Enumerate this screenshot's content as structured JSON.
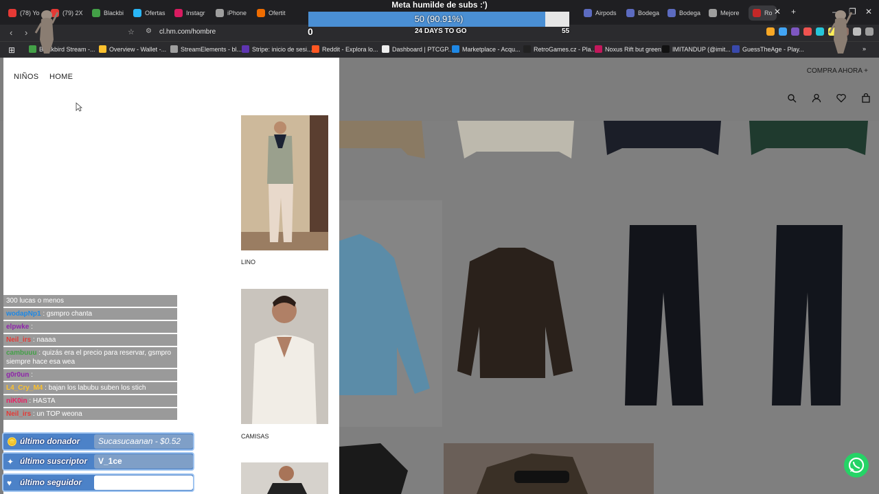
{
  "browser": {
    "tabs": [
      {
        "label": "(78) Yo",
        "color": "#e53935"
      },
      {
        "label": "(79) 2X",
        "color": "#e53935"
      },
      {
        "label": "Blackbi",
        "color": "#43a047"
      },
      {
        "label": "Ofertas",
        "color": "#29b6f6"
      },
      {
        "label": "Instagr",
        "color": "#d81b60"
      },
      {
        "label": "iPhone",
        "color": "#9e9e9e"
      },
      {
        "label": "Ofertit",
        "color": "#ef6c00"
      },
      {
        "label": "Airpods",
        "color": "#5c6bc0"
      },
      {
        "label": "Bodega",
        "color": "#5c6bc0"
      },
      {
        "label": "Bodega",
        "color": "#5c6bc0"
      },
      {
        "label": "Mejore",
        "color": "#9e9e9e"
      },
      {
        "label": "Ro",
        "color": "#c62828"
      }
    ],
    "url": "cl.hm.com/hombre",
    "bookmarks": [
      {
        "label": "Blackbird Stream -...",
        "color": "#43a047"
      },
      {
        "label": "Overview - Wallet -...",
        "color": "#fbc02d"
      },
      {
        "label": "StreamElements - bl...",
        "color": "#9e9e9e"
      },
      {
        "label": "Stripe: inicio de sesi...",
        "color": "#5e35b1"
      },
      {
        "label": "Reddit - Explora lo...",
        "color": "#ff5722"
      },
      {
        "label": "Dashboard | PTCGP...",
        "color": "#eeeeee"
      },
      {
        "label": "Marketplace - Acqu...",
        "color": "#1e88e5"
      },
      {
        "label": "RetroGames.cz - Pla...",
        "color": "#212121"
      },
      {
        "label": "Noxus Rift but green",
        "color": "#c2185b"
      },
      {
        "label": "IMITANDUP (@imit...",
        "color": "#111111"
      },
      {
        "label": "GuessTheAge - Play...",
        "color": "#3949ab"
      }
    ]
  },
  "goal": {
    "title": "Meta humilde de subs :')",
    "progress_text": "50 (90.91%)",
    "progress": 0.9091,
    "start": "0",
    "days": "24 DAYS TO GO",
    "target": "55"
  },
  "shop": {
    "compra": "COMPRA AHORA",
    "menu": [
      "NIÑOS",
      "HOME"
    ],
    "cards": [
      {
        "caption": "LINO"
      },
      {
        "caption": "CAMISAS"
      }
    ]
  },
  "chat": [
    {
      "user": "",
      "text": "300 lucas o menos",
      "color": "#ffffff"
    },
    {
      "user": "wodapNp1",
      "text": ": gsmpro chanta",
      "color": "#1e88e5"
    },
    {
      "user": "elpwke",
      "text": ":",
      "color": "#8e24aa"
    },
    {
      "user": "Neil_irs",
      "text": ": naaaa",
      "color": "#e53935"
    },
    {
      "user": "cambuuu",
      "text": ": quizás era el precio para reservar, gsmpro siempre hace esa wea",
      "color": "#43a047"
    },
    {
      "user": "g0r0un",
      "text": ":",
      "color": "#8e24aa"
    },
    {
      "user": "L4_Cry_M4",
      "text": ": bajan los labubu suben los stich",
      "color": "#fbc02d"
    },
    {
      "user": "niK0in",
      "text": ": HASTA",
      "color": "#e91e63"
    },
    {
      "user": "Neil_irs",
      "text": ": un TOP weona",
      "color": "#e53935"
    }
  ],
  "alerts": [
    {
      "label": "último donador",
      "value": "Sucasucaanan - $0.52"
    },
    {
      "label": "último suscriptor",
      "value": "V_1ce"
    },
    {
      "label": "último seguidor",
      "value": ""
    }
  ]
}
